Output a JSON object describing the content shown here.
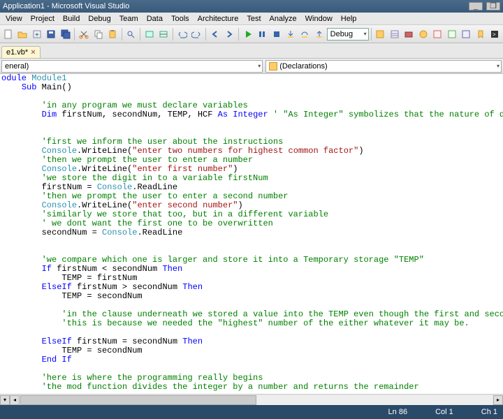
{
  "window": {
    "title": "Application1 - Microsoft Visual Studio"
  },
  "menus": [
    "View",
    "Project",
    "Build",
    "Debug",
    "Team",
    "Data",
    "Tools",
    "Architecture",
    "Test",
    "Analyze",
    "Window",
    "Help"
  ],
  "toolbar_combo": "Debug",
  "tab": {
    "name": "e1.vb*",
    "closable": true
  },
  "nav": {
    "left": "eneral)",
    "right": "(Declarations)"
  },
  "code_lines": [
    [
      [
        "kb",
        "odule "
      ],
      [
        "tb",
        "Module1"
      ]
    ],
    [
      [
        "",
        "    "
      ],
      [
        "kb",
        "Sub"
      ],
      [
        "",
        " Main()"
      ]
    ],
    [
      [
        "",
        ""
      ]
    ],
    [
      [
        "",
        "        "
      ],
      [
        "cm",
        "'in any program we must declare variables"
      ]
    ],
    [
      [
        "",
        "        "
      ],
      [
        "kb",
        "Dim"
      ],
      [
        "",
        " firstNum, secondNum, TEMP, HCF "
      ],
      [
        "kb",
        "As Integer"
      ],
      [
        "",
        " "
      ],
      [
        "cm",
        "' \"As Integer\" symbolizes that the nature of data for these variables ar"
      ]
    ],
    [
      [
        "",
        ""
      ]
    ],
    [
      [
        "",
        ""
      ]
    ],
    [
      [
        "",
        "        "
      ],
      [
        "cm",
        "'first we inform the user about the instructions"
      ]
    ],
    [
      [
        "",
        "        "
      ],
      [
        "tb",
        "Console"
      ],
      [
        "",
        ".WriteLine("
      ],
      [
        "st",
        "\"enter two numbers for highest common factor\""
      ],
      [
        "",
        ")"
      ]
    ],
    [
      [
        "",
        "        "
      ],
      [
        "cm",
        "'then we prompt the user to enter a number"
      ]
    ],
    [
      [
        "",
        "        "
      ],
      [
        "tb",
        "Console"
      ],
      [
        "",
        ".WriteLine("
      ],
      [
        "st",
        "\"enter first number\""
      ],
      [
        "",
        ")"
      ]
    ],
    [
      [
        "",
        "        "
      ],
      [
        "cm",
        "'we store the digit in to a variable firstNum"
      ]
    ],
    [
      [
        "",
        "        firstNum = "
      ],
      [
        "tb",
        "Console"
      ],
      [
        "",
        ".ReadLine"
      ]
    ],
    [
      [
        "",
        "        "
      ],
      [
        "cm",
        "'then we prompt the user to enter a second number"
      ]
    ],
    [
      [
        "",
        "        "
      ],
      [
        "tb",
        "Console"
      ],
      [
        "",
        ".WriteLine("
      ],
      [
        "st",
        "\"enter second number\""
      ],
      [
        "",
        ")"
      ]
    ],
    [
      [
        "",
        "        "
      ],
      [
        "cm",
        "'similarly we store that too, but in a different variable"
      ]
    ],
    [
      [
        "",
        "        "
      ],
      [
        "cm",
        "' we dont want the first one to be overwritten"
      ]
    ],
    [
      [
        "",
        "        secondNum = "
      ],
      [
        "tb",
        "Console"
      ],
      [
        "",
        ".ReadLine"
      ]
    ],
    [
      [
        "",
        ""
      ]
    ],
    [
      [
        "",
        ""
      ]
    ],
    [
      [
        "",
        "        "
      ],
      [
        "cm",
        "'we compare which one is larger and store it into a Temporary storage \"TEMP\""
      ]
    ],
    [
      [
        "",
        "        "
      ],
      [
        "kb",
        "If"
      ],
      [
        "",
        " firstNum < secondNum "
      ],
      [
        "kb",
        "Then"
      ]
    ],
    [
      [
        "",
        "            TEMP = firstNum"
      ]
    ],
    [
      [
        "",
        "        "
      ],
      [
        "kb",
        "ElseIf"
      ],
      [
        "",
        " firstNum > secondNum "
      ],
      [
        "kb",
        "Then"
      ]
    ],
    [
      [
        "",
        "            TEMP = secondNum"
      ]
    ],
    [
      [
        "",
        ""
      ]
    ],
    [
      [
        "",
        "            "
      ],
      [
        "cm",
        "'in the clause underneath we stored a value into the TEMP even though the first and second numbers were equal"
      ]
    ],
    [
      [
        "",
        "            "
      ],
      [
        "cm",
        "'this is because we needed the \"highest\" number of the either whatever it may be."
      ]
    ],
    [
      [
        "",
        ""
      ]
    ],
    [
      [
        "",
        "        "
      ],
      [
        "kb",
        "ElseIf"
      ],
      [
        "",
        " firstNum = secondNum "
      ],
      [
        "kb",
        "Then"
      ]
    ],
    [
      [
        "",
        "            TEMP = secondNum"
      ]
    ],
    [
      [
        "",
        "        "
      ],
      [
        "kb",
        "End If"
      ]
    ],
    [
      [
        "",
        ""
      ]
    ],
    [
      [
        "",
        "        "
      ],
      [
        "cm",
        "'here is where the programming really begins"
      ]
    ],
    [
      [
        "",
        "        "
      ],
      [
        "cm",
        "'the mod function divides the integer by a number and returns the remainder"
      ]
    ]
  ],
  "status": {
    "ln": "Ln 86",
    "col": "Col 1",
    "ch": "Ch 1"
  }
}
